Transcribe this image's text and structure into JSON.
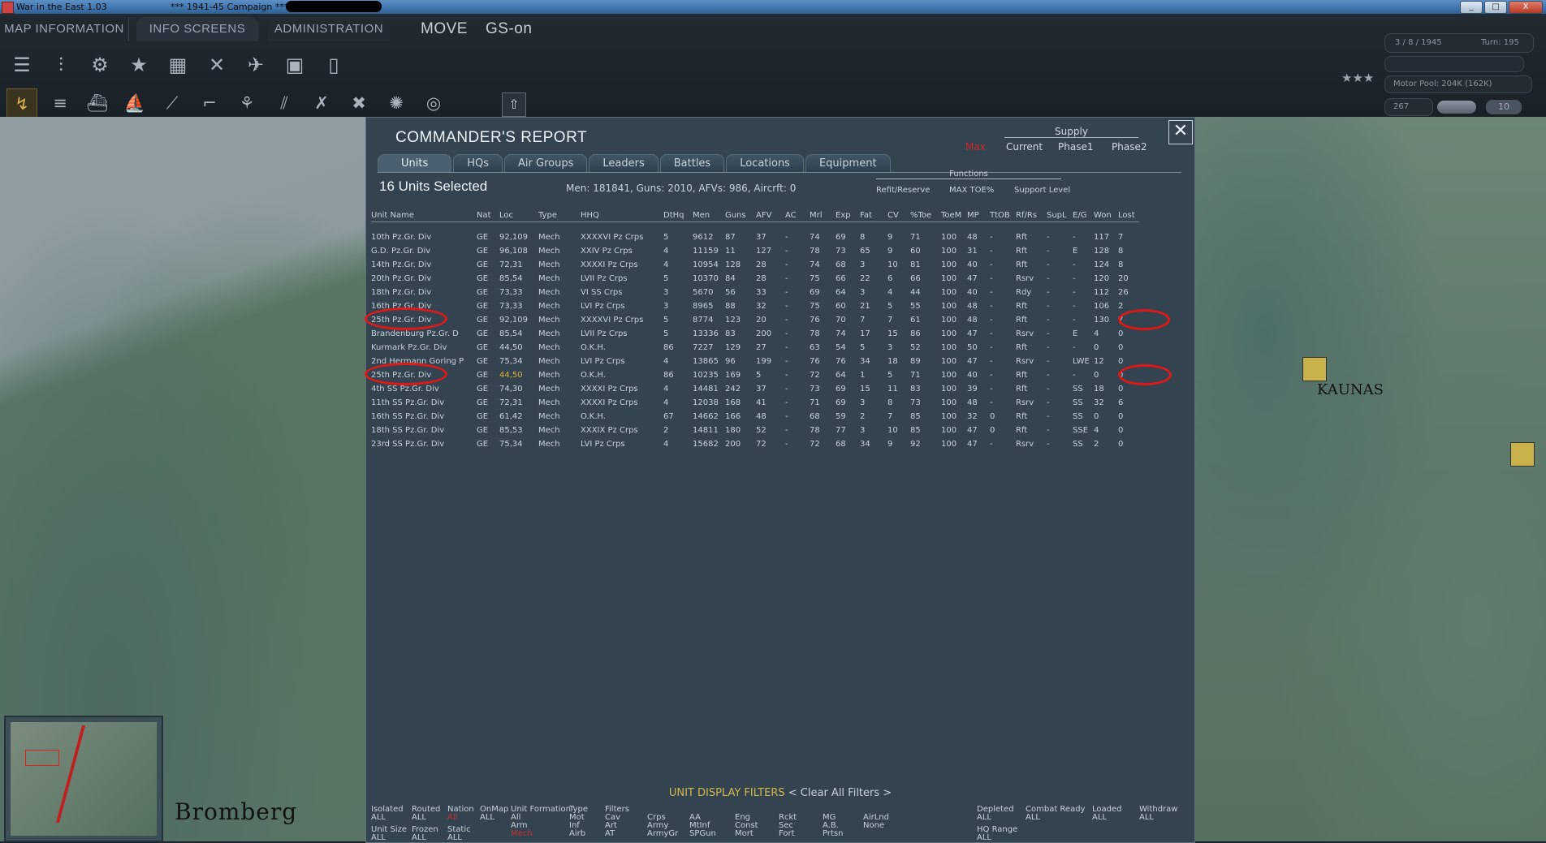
{
  "titlebar": {
    "app_title": "War in the East 1.03",
    "campaign": "***  1941-45 Campaign  ***",
    "win_minimize": "_",
    "win_maximize": "□",
    "win_close": "X"
  },
  "menu": {
    "map_information": "MAP INFORMATION",
    "info_screens": "INFO SCREENS",
    "administration": "ADMINISTRATION",
    "move": "MOVE",
    "gs_on": "GS-on"
  },
  "status": {
    "date": "3 / 8 / 1945",
    "turn": "Turn: 195",
    "motor_pool": "Motor Pool: 204K (162K)",
    "count": "267",
    "stars": "★★★",
    "pill_value": "10"
  },
  "toolbar_row2_keys": [
    "F1",
    "F2",
    "F3",
    "F4",
    "F5",
    "F6",
    "F7",
    "F8",
    "F9",
    "F10",
    "F11",
    "F12"
  ],
  "map": {
    "city_left": "Bromberg",
    "city_right": "KAUNAS"
  },
  "report": {
    "title": "COMMANDER'S REPORT",
    "close": "✕",
    "supply": {
      "label": "Supply",
      "options": [
        "Max",
        "Current",
        "Phase1",
        "Phase2"
      ],
      "selected": "Max"
    },
    "tabs": [
      "Units",
      "HQs",
      "Air Groups",
      "Leaders",
      "Battles",
      "Locations",
      "Equipment"
    ],
    "active_tab": "Units",
    "selected_count": "16 Units Selected",
    "summary": "Men: 181841, Guns: 2010, AFVs: 986, Aircrft: 0",
    "functions": {
      "label": "Functions",
      "items": [
        "Refit/Reserve",
        "MAX TOE%",
        "Support Level"
      ]
    },
    "columns": [
      "Unit Name",
      "Nat",
      "Loc",
      "Type",
      "HHQ",
      "DtHq",
      "Men",
      "Guns",
      "AFV",
      "AC",
      "Mrl",
      "Exp",
      "Fat",
      "CV",
      "%Toe",
      "ToeM",
      "MP",
      "TtOB",
      "Rf/Rs",
      "SupL",
      "E/G",
      "Won",
      "Lost"
    ],
    "rows": [
      [
        "10th Pz.Gr. Div",
        "GE",
        "92,109",
        "Mech",
        "XXXXVI Pz Crps",
        "5",
        "9612",
        "87",
        "37",
        "-",
        "74",
        "69",
        "8",
        "9",
        "71",
        "100",
        "48",
        "-",
        "Rft",
        "-",
        "-",
        "117",
        "7"
      ],
      [
        "G.D. Pz.Gr. Div",
        "GE",
        "96,108",
        "Mech",
        "XXIV Pz Crps",
        "4",
        "11159",
        "11",
        "127",
        "-",
        "78",
        "73",
        "65",
        "9",
        "60",
        "100",
        "31",
        "-",
        "Rft",
        "-",
        "E",
        "128",
        "8"
      ],
      [
        "14th Pz.Gr. Div",
        "GE",
        "72,31",
        "Mech",
        "XXXXI Pz Crps",
        "4",
        "10954",
        "128",
        "28",
        "-",
        "74",
        "68",
        "3",
        "10",
        "81",
        "100",
        "40",
        "-",
        "Rft",
        "-",
        "-",
        "124",
        "8"
      ],
      [
        "20th Pz.Gr. Div",
        "GE",
        "85,54",
        "Mech",
        "LVII Pz Crps",
        "5",
        "10370",
        "84",
        "28",
        "-",
        "75",
        "66",
        "22",
        "6",
        "66",
        "100",
        "47",
        "-",
        "Rsrv",
        "-",
        "-",
        "120",
        "20"
      ],
      [
        "18th Pz.Gr. Div",
        "GE",
        "73,33",
        "Mech",
        "VI SS Crps",
        "3",
        "5670",
        "56",
        "33",
        "-",
        "69",
        "64",
        "3",
        "4",
        "44",
        "100",
        "40",
        "-",
        "Rdy",
        "-",
        "-",
        "112",
        "26"
      ],
      [
        "16th Pz.Gr. Div",
        "GE",
        "73,33",
        "Mech",
        "LVI Pz Crps",
        "3",
        "8965",
        "88",
        "32",
        "-",
        "75",
        "60",
        "21",
        "5",
        "55",
        "100",
        "48",
        "-",
        "Rft",
        "-",
        "-",
        "106",
        "2"
      ],
      [
        "25th Pz.Gr. Div",
        "GE",
        "92,109",
        "Mech",
        "XXXXVI Pz Crps",
        "5",
        "8774",
        "123",
        "20",
        "-",
        "76",
        "70",
        "7",
        "7",
        "61",
        "100",
        "48",
        "-",
        "Rft",
        "-",
        "-",
        "130",
        "7"
      ],
      [
        "Brandenburg Pz.Gr. D",
        "GE",
        "85,54",
        "Mech",
        "LVII Pz Crps",
        "5",
        "13336",
        "83",
        "200",
        "-",
        "78",
        "74",
        "17",
        "15",
        "86",
        "100",
        "47",
        "-",
        "Rsrv",
        "-",
        "E",
        "4",
        "0"
      ],
      [
        "Kurmark Pz.Gr. Div",
        "GE",
        "44,50",
        "Mech",
        "O.K.H.",
        "86",
        "7227",
        "129",
        "27",
        "-",
        "63",
        "54",
        "5",
        "3",
        "52",
        "100",
        "50",
        "-",
        "Rft",
        "-",
        "-",
        "0",
        "0"
      ],
      [
        "2nd Hermann Goring P",
        "GE",
        "75,34",
        "Mech",
        "LVI Pz Crps",
        "4",
        "13865",
        "96",
        "199",
        "-",
        "76",
        "76",
        "34",
        "18",
        "89",
        "100",
        "47",
        "-",
        "Rsrv",
        "-",
        "LWE",
        "12",
        "0"
      ],
      [
        "25th Pz.Gr. Div",
        "GE",
        "44,50",
        "Mech",
        "O.K.H.",
        "86",
        "10235",
        "169",
        "5",
        "-",
        "72",
        "64",
        "1",
        "5",
        "71",
        "100",
        "40",
        "-",
        "Rft",
        "-",
        "-",
        "0",
        "0"
      ],
      [
        "4th SS Pz.Gr. Div",
        "GE",
        "74,30",
        "Mech",
        "XXXXI Pz Crps",
        "4",
        "14481",
        "242",
        "37",
        "-",
        "73",
        "69",
        "15",
        "11",
        "83",
        "100",
        "39",
        "-",
        "Rft",
        "-",
        "SS",
        "18",
        "0"
      ],
      [
        "11th SS Pz.Gr. Div",
        "GE",
        "72,31",
        "Mech",
        "XXXXI Pz Crps",
        "4",
        "12038",
        "168",
        "41",
        "-",
        "71",
        "69",
        "3",
        "8",
        "73",
        "100",
        "48",
        "-",
        "Rsrv",
        "-",
        "SS",
        "32",
        "6"
      ],
      [
        "16th SS Pz.Gr. Div",
        "GE",
        "61,42",
        "Mech",
        "O.K.H.",
        "67",
        "14662",
        "166",
        "48",
        "-",
        "68",
        "59",
        "2",
        "7",
        "85",
        "100",
        "32",
        "0",
        "Rft",
        "-",
        "SS",
        "0",
        "0"
      ],
      [
        "18th SS Pz.Gr. Div",
        "GE",
        "85,53",
        "Mech",
        "XXXIX Pz Crps",
        "2",
        "14811",
        "180",
        "52",
        "-",
        "78",
        "77",
        "3",
        "10",
        "85",
        "100",
        "47",
        "0",
        "Rft",
        "-",
        "SSE",
        "4",
        "0"
      ],
      [
        "23rd SS Pz.Gr. Div",
        "GE",
        "75,34",
        "Mech",
        "LVI Pz Crps",
        "4",
        "15682",
        "200",
        "72",
        "-",
        "72",
        "68",
        "34",
        "9",
        "92",
        "100",
        "47",
        "-",
        "Rsrv",
        "-",
        "SS",
        "2",
        "0"
      ]
    ],
    "filters": {
      "title": "UNIT DISPLAY FILTERS",
      "clear": "< Clear All Filters >",
      "isolated": {
        "label": "Isolated",
        "value": "ALL"
      },
      "routed": {
        "label": "Routed",
        "value": "ALL"
      },
      "nation": {
        "label": "Nation",
        "value": "All"
      },
      "onmap": {
        "label": "OnMap",
        "value": "ALL"
      },
      "unit_formation": {
        "label": "Unit  Formation",
        "values": [
          "All",
          "Arm",
          "Mech"
        ]
      },
      "type": {
        "label": "Type",
        "values": [
          "Mot",
          "Inf",
          "Airb"
        ]
      },
      "filters_col": {
        "label": "Filters",
        "values": [
          "Cav",
          "Art",
          "AT"
        ]
      },
      "col_crps": [
        "Crps",
        "Army",
        "ArmyGr"
      ],
      "col_aa": [
        "AA",
        "MtInf",
        "SPGun"
      ],
      "col_eng": [
        "Eng",
        "Const",
        "Mort"
      ],
      "col_rckt": [
        "Rckt",
        "Sec",
        "Fort"
      ],
      "col_mg": [
        "MG",
        "A.B.",
        "Prtsn"
      ],
      "col_airlnd": [
        "AirLnd",
        "None"
      ],
      "unit_size": {
        "label": "Unit Size",
        "value": "ALL"
      },
      "frozen": {
        "label": "Frozen",
        "value": "ALL"
      },
      "static": {
        "label": "Static",
        "value": "ALL"
      },
      "depleted": {
        "label": "Depleted",
        "value": "ALL"
      },
      "combat_ready": {
        "label": "Combat Ready",
        "value": "ALL"
      },
      "loaded": {
        "label": "Loaded",
        "value": "ALL"
      },
      "withdraw": {
        "label": "Withdraw",
        "value": "ALL"
      },
      "hq_range": {
        "label": "HQ Range",
        "value": "ALL"
      }
    }
  },
  "colors": {
    "panel": "#33434f",
    "highlight_red": "#e01818",
    "accent_yellow": "#d2b84c"
  }
}
